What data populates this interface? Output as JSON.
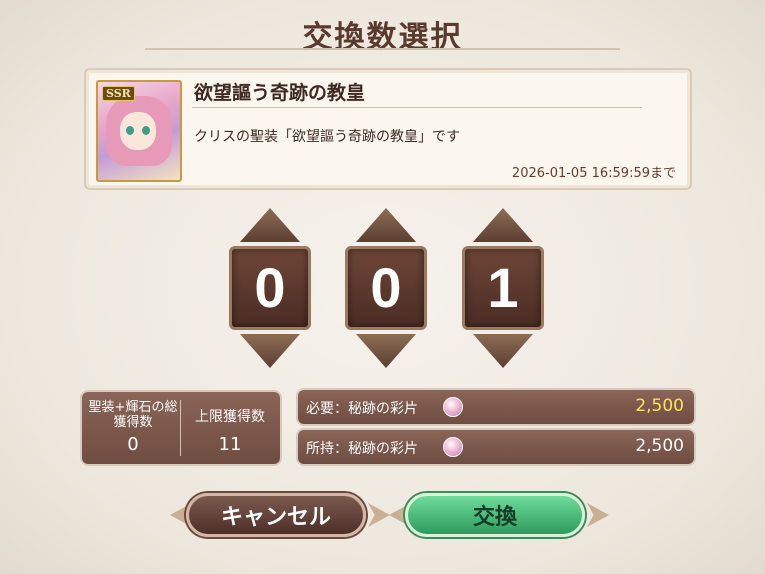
{
  "header": {
    "title": "交換数選択"
  },
  "item": {
    "rarity": "SSR",
    "name": "欲望謳う奇跡の教皇",
    "description": "クリスの聖装「欲望謳う奇跡の教皇」です",
    "deadline": "2026-01-05 16:59:59まで"
  },
  "counter": {
    "digits": [
      "0",
      "0",
      "1"
    ]
  },
  "stats": {
    "total_label": "聖装+輝石の総獲得数",
    "total_value": "0",
    "limit_label": "上限獲得数",
    "limit_value": "11"
  },
  "cost": {
    "required_label": "必要：秘跡の彩片",
    "required_value": "2,500",
    "owned_label": "所持：秘跡の彩片",
    "owned_value": "2,500",
    "required_color": "#ffe25a",
    "currency_icon": "sacrament-fragment-icon"
  },
  "buttons": {
    "cancel_label": "キャンセル",
    "confirm_label": "交換"
  },
  "colors": {
    "confirm": "#3fbf74",
    "panel": "#7a5649",
    "title": "#5a3a2e"
  }
}
